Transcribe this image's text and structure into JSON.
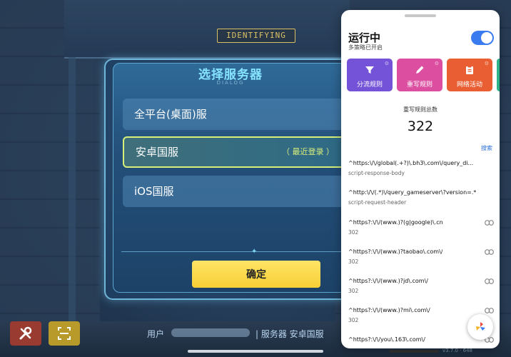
{
  "game": {
    "badge": "IDENTIFYING",
    "dialog": {
      "title": "选择服务器",
      "subtitle": "DIALOG",
      "options": [
        {
          "label": "全平台(桌面)服",
          "tag": ""
        },
        {
          "label": "安卓国服",
          "tag": "（ 最近登录 ）"
        },
        {
          "label": "iOS国服",
          "tag": ""
        }
      ],
      "confirm": "确定"
    },
    "bottom": {
      "user_label": "用户",
      "server_text": "| 服务器  安卓国服",
      "version": "v3.7.0 · 648"
    }
  },
  "panel": {
    "status_title": "运行中",
    "status_sub": "多策略已开启",
    "toggle_on": true,
    "tabs": [
      {
        "label": "分流规则",
        "icon": "filter-icon",
        "color": "#7453d8"
      },
      {
        "label": "重写规则",
        "icon": "pencil-icon",
        "color": "#dc4fa0"
      },
      {
        "label": "网络活动",
        "icon": "clipboard-icon",
        "color": "#e95f33"
      }
    ],
    "stat_label": "重写规则总数",
    "stat_value": "322",
    "search": "搜索",
    "rules": [
      {
        "pattern": "^https:\\/\\/global(.+?)\\.bh3\\.com\\/query_di...",
        "type": "script-response-body",
        "icon": ""
      },
      {
        "pattern": "^http:\\/\\/(.*)\\/query_gameserver\\?version=.*",
        "type": "script-request-header",
        "icon": ""
      },
      {
        "pattern": "^https?:\\/\\/(www.)?(g|google)\\.cn",
        "type": "302",
        "icon": "link-icon"
      },
      {
        "pattern": "^https?:\\/\\/(www.)?taobao\\.com\\/",
        "type": "302",
        "icon": "link-icon"
      },
      {
        "pattern": "^https?:\\/\\/(www.)?jd\\.com\\/",
        "type": "302",
        "icon": "link-icon"
      },
      {
        "pattern": "^https?:\\/\\/(www.)?mi\\.com\\/",
        "type": "302",
        "icon": "link-icon"
      },
      {
        "pattern": "^https?:\\/\\/you\\.163\\.com\\/",
        "type": "302",
        "icon": "link-icon"
      }
    ]
  }
}
